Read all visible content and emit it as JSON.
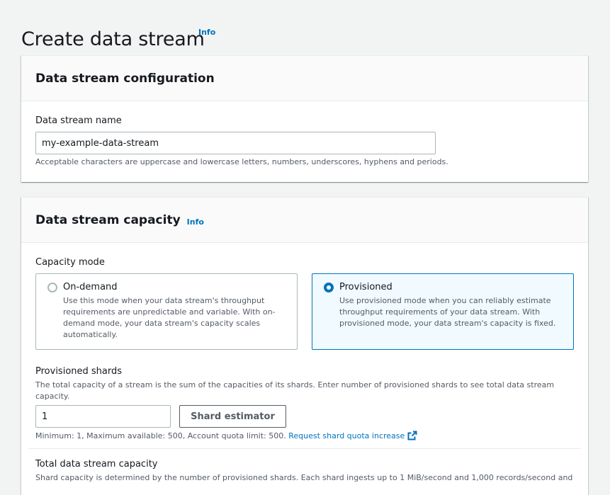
{
  "page": {
    "title": "Create data stream",
    "info": "Info"
  },
  "config_card": {
    "title": "Data stream configuration",
    "name_label": "Data stream name",
    "name_value": "my-example-data-stream",
    "name_hint": "Acceptable characters are uppercase and lowercase letters, numbers, underscores, hyphens and periods."
  },
  "capacity_card": {
    "title": "Data stream capacity",
    "info": "Info",
    "mode_label": "Capacity mode",
    "options": [
      {
        "label": "On-demand",
        "description": "Use this mode when your data stream's throughput requirements are unpredictable and variable. With on-demand mode, your data stream's capacity scales automatically.",
        "selected": false
      },
      {
        "label": "Provisioned",
        "description": "Use provisioned mode when you can reliably estimate throughput requirements of your data stream. With provisioned mode, your data stream's capacity is fixed.",
        "selected": true
      }
    ],
    "shards_label": "Provisioned shards",
    "shards_desc": "The total capacity of a stream is the sum of the capacities of its shards. Enter number of provisioned shards to see total data stream capacity.",
    "shards_value": "1",
    "estimator_button": "Shard estimator",
    "limits_text": "Minimum: 1, Maximum available: 500, Account quota limit: 500.",
    "quota_link": "Request shard quota increase",
    "total_label": "Total data stream capacity",
    "total_desc": "Shard capacity is determined by the number of provisioned shards. Each shard ingests up to 1 MiB/second and 1,000 records/second and"
  },
  "colors": {
    "accent": "#0073bb",
    "selected_bg": "#f1faff",
    "page_bg": "#f2f3f3"
  },
  "icons": {
    "external_link": "external-link-icon"
  }
}
